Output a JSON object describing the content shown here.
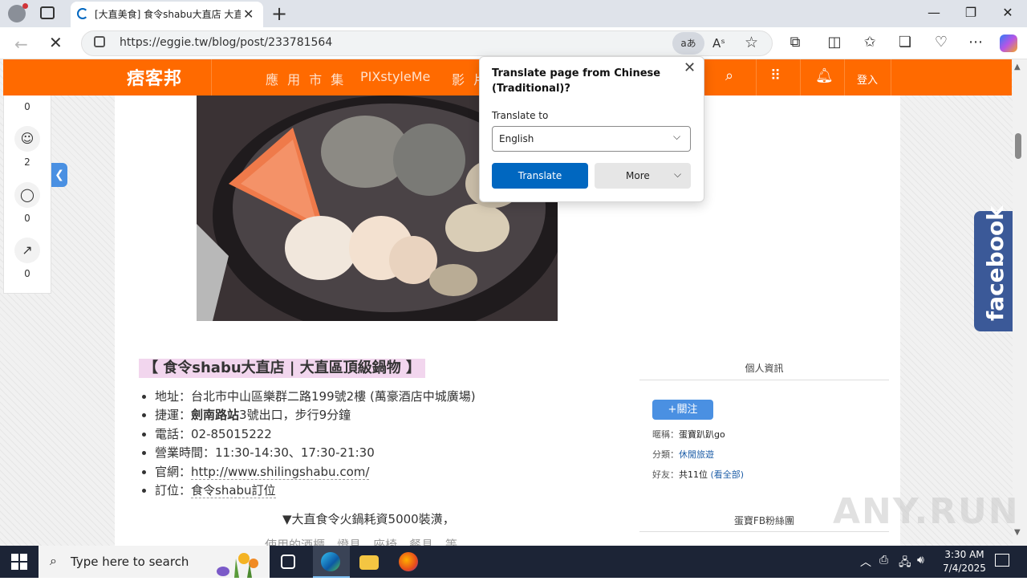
{
  "browser": {
    "tab_title": "[大直美食] 食令shabu大直店 大直…",
    "tab_close": "✕",
    "new_tab": "+",
    "url": "https://eggie.tw/blog/post/233781564",
    "translate_chip": "aあ",
    "read_aloud": "Aˢ",
    "window_controls": {
      "minimize": "—",
      "maximize": "❐",
      "close": "✕"
    }
  },
  "site": {
    "logo": "痞客邦",
    "nav": [
      "應 用 市 集",
      "PIXstyleMe",
      "影 片"
    ],
    "login": "登入",
    "header_icons": [
      "search-icon",
      "apps-icon",
      "bell-icon"
    ]
  },
  "rail": {
    "counts": [
      "0",
      "2",
      "0",
      "0"
    ],
    "toggle": "❮"
  },
  "article": {
    "heading": "【 食令shabu大直店 | 大直區頂級鍋物 】",
    "info": [
      "地址：台北市中山區樂群二路199號2樓 (萬豪酒店中城廣場)",
      "捷運：",
      "電話：02-85015222",
      "營業時間：11:30-14:30、17:30-21:30",
      "官網：",
      "訂位："
    ],
    "mrt_station": "劍南路站",
    "mrt_rest": "3號出口，步行9分鐘",
    "website": "http://www.shilingshabu.com/",
    "booking": "食令shabu訂位",
    "caption": "▼大直食令火鍋耗資5000裝潢，",
    "caption2": "使用的酒櫃、燈具、座椅、餐具…等"
  },
  "sidebar": {
    "profile_title": "個人資訊",
    "follow": "+關注",
    "nickname_label": "暱稱：",
    "nickname": "蛋寶趴趴go",
    "category_label": "分類：",
    "category": "休閒旅遊",
    "friends_label": "好友：",
    "friends": "共11位",
    "friends_link": "(看全部)",
    "fb_title": "蛋寶FB粉絲團"
  },
  "fb_tab": "facebook",
  "translate_popup": {
    "title": "Translate page from Chinese (Traditional)?",
    "label": "Translate to",
    "selected": "English",
    "translate_btn": "Translate",
    "more_btn": "More",
    "close": "✕"
  },
  "watermark": "ANY.RUN",
  "taskbar": {
    "search_placeholder": "Type here to search",
    "time": "3:30 AM",
    "date": "7/4/2025"
  }
}
